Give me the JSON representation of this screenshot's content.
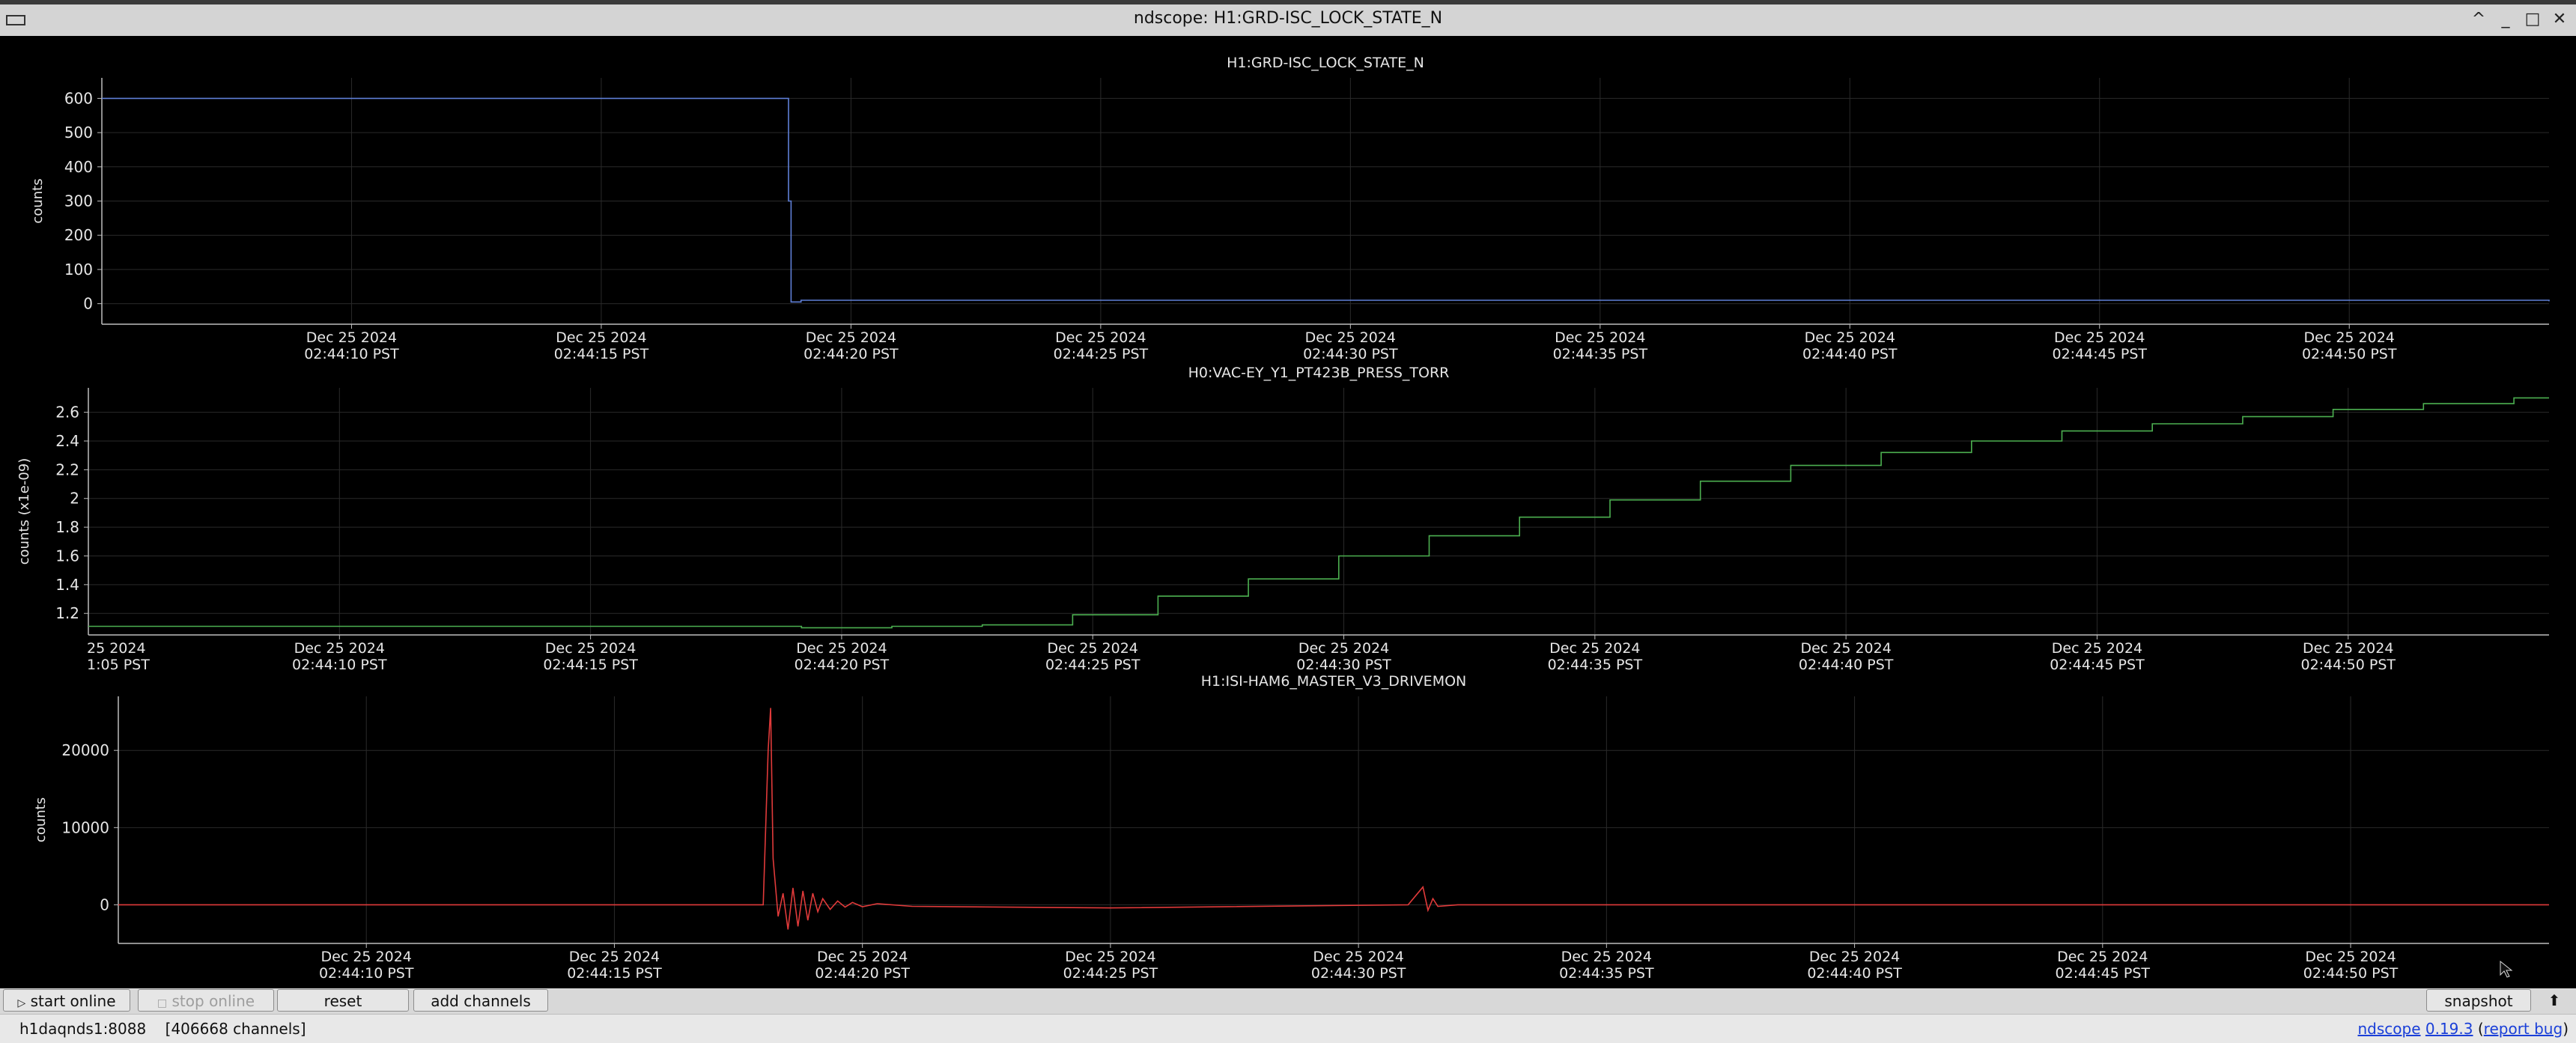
{
  "window": {
    "title": "ndscope: H1:GRD-ISC_LOCK_STATE_N",
    "buttons": [
      "^",
      "_",
      "□",
      "✕"
    ]
  },
  "colors": {
    "background": "#000000",
    "panel1": "#5f7fd6",
    "panel2": "#4caf50",
    "panel3": "#e03a3a",
    "grid": "#2a2a2a",
    "axis": "#bdbdbd",
    "text": "#e6e6e6"
  },
  "chart_data": [
    {
      "type": "line",
      "title": "H1:GRD-ISC_LOCK_STATE_N",
      "ylabel": "counts",
      "xlim": [
        "02:44:05",
        "02:44:54"
      ],
      "ylim": [
        -60,
        660
      ],
      "yticks": [
        "600",
        "500",
        "400",
        "300",
        "200",
        "100",
        "0"
      ],
      "ytick_values": [
        600,
        500,
        400,
        300,
        200,
        100,
        0
      ],
      "xtick_date": "Dec 25 2024",
      "xticks": [
        "02:44:10 PST",
        "02:44:15 PST",
        "02:44:20 PST",
        "02:44:25 PST",
        "02:44:30 PST",
        "02:44:35 PST",
        "02:44:40 PST",
        "02:44:45 PST",
        "02:44:50 PST"
      ],
      "grid": true,
      "series": [
        {
          "x": [
            "02:44:05",
            "02:44:18.7",
            "02:44:18.75",
            "02:44:18.8",
            "02:44:19",
            "02:44:54"
          ],
          "y": [
            600,
            600,
            300,
            5,
            10,
            7
          ]
        }
      ]
    },
    {
      "type": "line",
      "title": "H0:VAC-EY_Y1_PT423B_PRESS_TORR",
      "ylabel": "counts (x1e-09)",
      "xlim": [
        "02:44:05",
        "02:44:54"
      ],
      "ylim": [
        1.05,
        2.77
      ],
      "yticks": [
        "2.6",
        "2.4",
        "2.2",
        "2",
        "1.8",
        "1.6",
        "1.4",
        "1.2"
      ],
      "ytick_values": [
        2.6,
        2.4,
        2.2,
        2.0,
        1.8,
        1.6,
        1.4,
        1.2
      ],
      "xtick_date": "Dec 25 2024",
      "xticks": [
        "02:44:10 PST",
        "02:44:15 PST",
        "02:44:20 PST",
        "02:44:25 PST",
        "02:44:30 PST",
        "02:44:35 PST",
        "02:44:40 PST",
        "02:44:45 PST",
        "02:44:50 PST"
      ],
      "partial_first_tick": [
        "25 2024",
        "1:05 PST"
      ],
      "grid": true,
      "series": [
        {
          "x": [
            "02:44:05",
            "02:44:19.2",
            "02:44:21",
            "02:44:22.8",
            "02:44:24.6",
            "02:44:26.3",
            "02:44:28.1",
            "02:44:29.9",
            "02:44:31.7",
            "02:44:33.5",
            "02:44:35.3",
            "02:44:37.1",
            "02:44:38.9",
            "02:44:40.7",
            "02:44:42.5",
            "02:44:44.3",
            "02:44:46.1",
            "02:44:47.9",
            "02:44:49.7",
            "02:44:51.5",
            "02:44:53.3",
            "02:44:54"
          ],
          "y": [
            1.11,
            1.1,
            1.11,
            1.12,
            1.19,
            1.32,
            1.44,
            1.6,
            1.74,
            1.87,
            1.99,
            2.12,
            2.23,
            2.32,
            2.4,
            2.47,
            2.52,
            2.57,
            2.62,
            2.66,
            2.7,
            2.7
          ]
        }
      ]
    },
    {
      "type": "line",
      "title": "H1:ISI-HAM6_MASTER_V3_DRIVEMON",
      "ylabel": "counts",
      "xlim": [
        "02:44:05",
        "02:44:54"
      ],
      "ylim": [
        -5000,
        27000
      ],
      "yticks": [
        "20000",
        "10000",
        "0"
      ],
      "ytick_values": [
        20000,
        10000,
        0
      ],
      "xtick_date": "Dec 25 2024",
      "xticks": [
        "02:44:10 PST",
        "02:44:15 PST",
        "02:44:20 PST",
        "02:44:25 PST",
        "02:44:30 PST",
        "02:44:35 PST",
        "02:44:40 PST",
        "02:44:45 PST",
        "02:44:50 PST"
      ],
      "grid": true,
      "series": [
        {
          "x": [
            "02:44:05",
            "02:44:18",
            "02:44:18.1",
            "02:44:18.15",
            "02:44:18.2",
            "02:44:18.3",
            "02:44:18.4",
            "02:44:18.5",
            "02:44:18.6",
            "02:44:18.7",
            "02:44:18.8",
            "02:44:18.9",
            "02:44:19",
            "02:44:19.1",
            "02:44:19.2",
            "02:44:19.35",
            "02:44:19.5",
            "02:44:19.65",
            "02:44:19.8",
            "02:44:20",
            "02:44:20.3",
            "02:44:21",
            "02:44:25",
            "02:44:31",
            "02:44:31.3",
            "02:44:31.4",
            "02:44:31.5",
            "02:44:31.6",
            "02:44:32",
            "02:44:40",
            "02:44:54"
          ],
          "y": [
            0,
            0,
            20000,
            25500,
            6000,
            -1500,
            1500,
            -3200,
            2200,
            -2800,
            1800,
            -2000,
            1500,
            -900,
            800,
            -600,
            500,
            -300,
            300,
            -250,
            150,
            -200,
            -400,
            0,
            2300,
            -700,
            800,
            -200,
            0,
            0,
            0
          ]
        }
      ]
    }
  ],
  "toolbar": {
    "start_online": "start online",
    "stop_online": "stop online",
    "reset": "reset",
    "add_channels": "add channels",
    "snapshot": "snapshot",
    "expand": "⬆"
  },
  "status": {
    "server": "h1daqnds1:8088",
    "channels": "[406668 channels]",
    "app_name": "ndscope",
    "version": "0.19.3",
    "report_bug": "report bug"
  }
}
